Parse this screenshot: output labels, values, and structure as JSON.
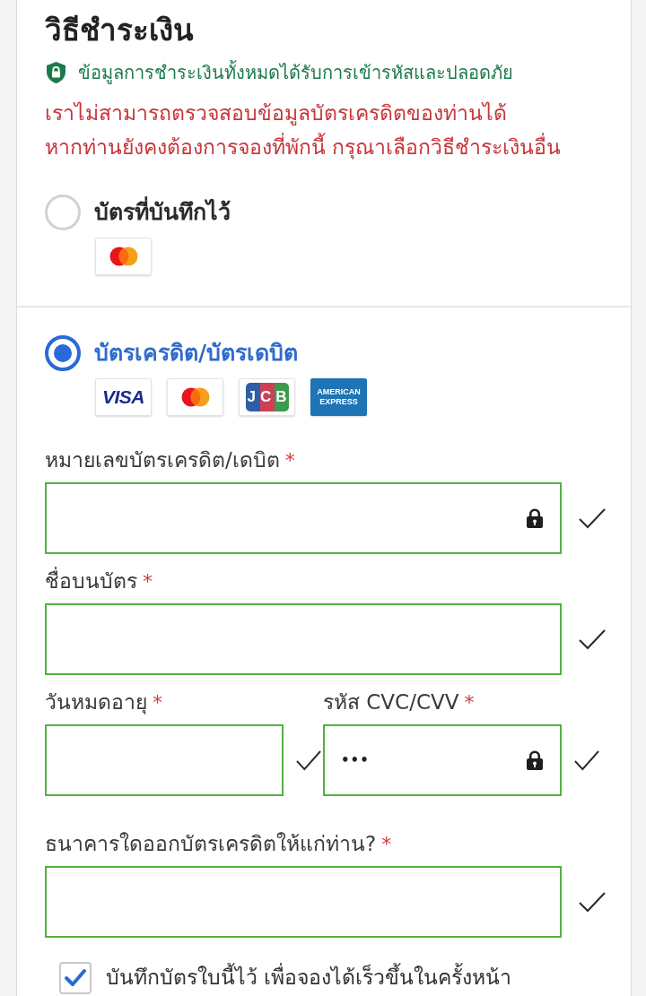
{
  "title": "วิธีชำระเงิน",
  "secure_note": "ข้อมูลการชำระเงินทั้งหมดได้รับการเข้ารหัสและปลอดภัย",
  "error_lines": [
    "เราไม่สามารถตรวจสอบข้อมูลบัตรเครดิตของท่านได้",
    "หากท่านยังคงต้องการจองที่พักนี้ กรุณาเลือกวิธีชำระเงินอื่น"
  ],
  "payment_methods": [
    {
      "label": "บัตรที่บันทึกไว้",
      "selected": false,
      "card_logos": [
        {
          "kind": "mastercard"
        }
      ]
    },
    {
      "label": "บัตรเครดิต/บัตรเดบิต",
      "selected": true,
      "card_logos": [
        {
          "kind": "visa",
          "text": "VISA"
        },
        {
          "kind": "mastercard"
        },
        {
          "kind": "jcb",
          "text": "JCB"
        },
        {
          "kind": "amex",
          "text": "AMERICAN EXPRESS"
        }
      ]
    }
  ],
  "card_form": {
    "rows": [
      [
        {
          "label": "หมายเลขบัตรเครดิต/เดบิต",
          "required_mark": "*",
          "kind": "secure",
          "valid": true
        }
      ],
      [
        {
          "label": "ชื่อบนบัตร",
          "required_mark": "*",
          "kind": "plain",
          "valid": true
        }
      ],
      [
        {
          "label": "วันหมดอายุ",
          "required_mark": "*",
          "kind": "plain",
          "valid": true
        },
        {
          "label": "รหัส CVC/CVV",
          "required_mark": "*",
          "kind": "secure",
          "valid": true,
          "value": "•••"
        }
      ],
      [
        {
          "label": "ธนาคารใดออกบัตรเครดิตให้แก่ท่าน?",
          "required_mark": "*",
          "kind": "plain",
          "valid": true
        }
      ]
    ]
  },
  "save_card": {
    "label": "บันทึกบัตรใบนี้ไว้ เพื่อจองได้เร็วขึ้นในครั้งหน้า",
    "checked": true
  }
}
